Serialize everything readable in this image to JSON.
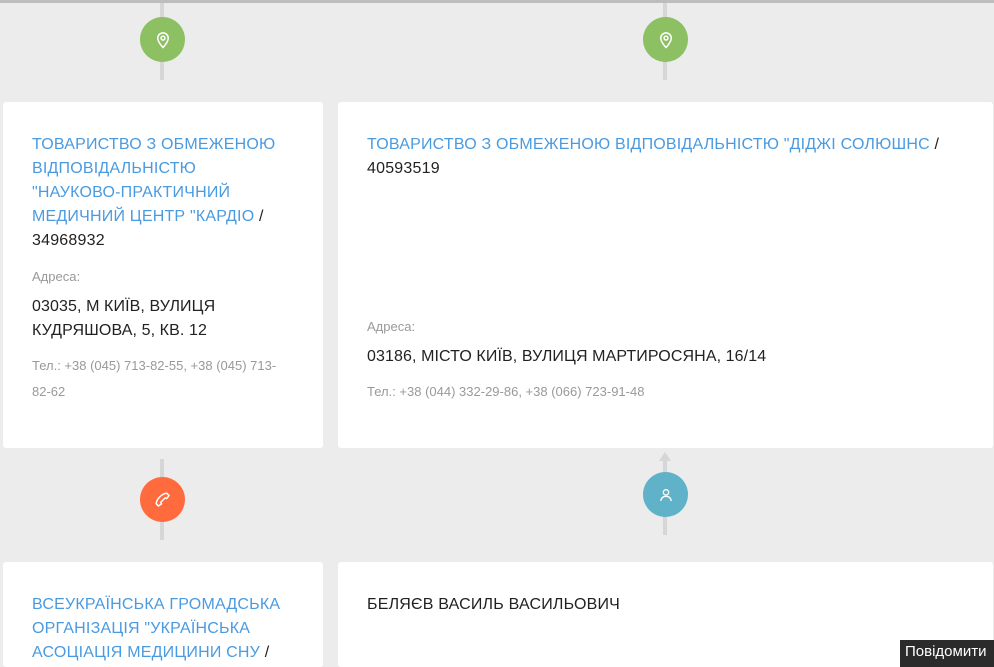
{
  "cards": [
    {
      "company": "ТОВАРИСТВО З ОБМЕЖЕНОЮ ВІДПОВІДАЛЬНІСТЮ \"НАУКОВО-ПРАКТИЧНИЙ МЕДИЧНИЙ ЦЕНТР \"КАРДІО",
      "sep": " / ",
      "code": "34968932",
      "address_label": "Адреса:",
      "address": "03035, М КИЇВ, ВУЛИЦЯ КУДРЯШОВА, 5, КВ. 12",
      "tel": "Тел.: +38 (045) 713-82-55, +38 (045) 713-82-62"
    },
    {
      "company": "ТОВАРИСТВО З ОБМЕЖЕНОЮ ВІДПОВІДАЛЬНІСТЮ \"ДІДЖІ СОЛЮШНС",
      "sep": " / ",
      "code": "40593519",
      "address_label": "Адреса:",
      "address": "03186, МІСТО КИЇВ, ВУЛИЦЯ МАРТИРОСЯНА, 16/14",
      "tel": "Тел.: +38 (044) 332-29-86, +38 (066) 723-91-48"
    },
    {
      "company": "ВСЕУКРАЇНСЬКА ГРОМАДСЬКА ОРГАНІЗАЦІЯ \"УКРАЇНСЬКА АСОЦІАЦІЯ МЕДИЦИНИ СНУ",
      "sep": " /"
    },
    {
      "person": "БЕЛЯЄВ ВАСИЛЬ ВАСИЛЬОВИЧ"
    }
  ],
  "icons": {
    "node_1": "map-pin-icon",
    "node_2": "map-pin-icon",
    "node_3": "phone-icon",
    "node_4": "person-icon"
  },
  "colors": {
    "link": "#4a9ae0",
    "green": "#8cc063",
    "orange": "#ff6b3d",
    "teal": "#5fb2c8"
  },
  "report_button": "Повідомити"
}
